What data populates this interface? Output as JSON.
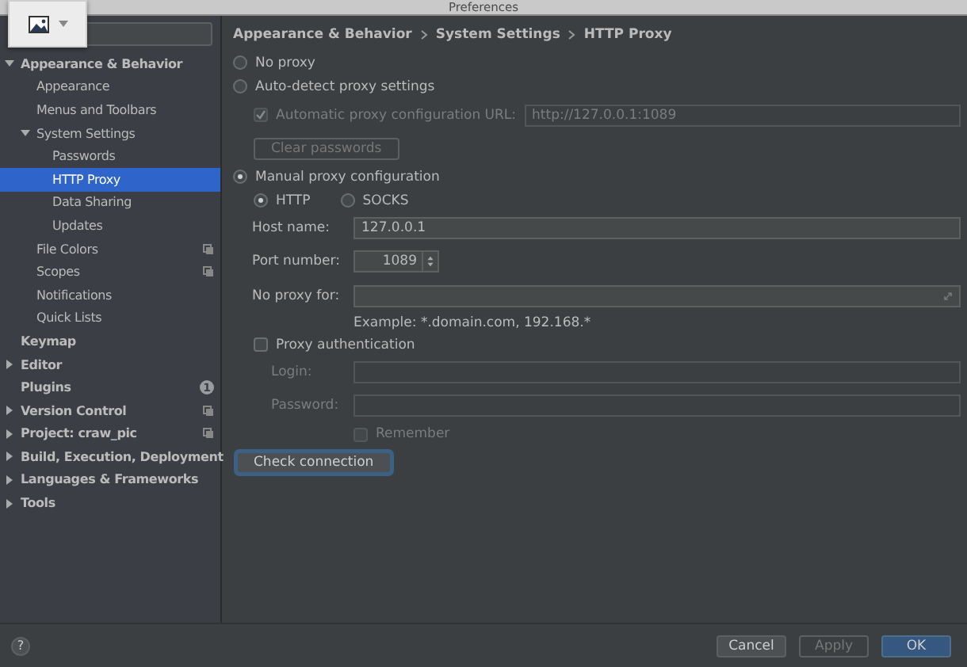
{
  "window": {
    "title": "Preferences"
  },
  "sidebar": {
    "items": [
      {
        "label": "Appearance & Behavior",
        "expanded": true,
        "selected": false,
        "children": [
          {
            "label": "Appearance",
            "selected": false
          },
          {
            "label": "Menus and Toolbars",
            "selected": false
          },
          {
            "label": "System Settings",
            "expanded": true,
            "selected": false,
            "children": [
              {
                "label": "Passwords",
                "selected": false
              },
              {
                "label": "HTTP Proxy",
                "selected": true
              },
              {
                "label": "Data Sharing",
                "selected": false
              },
              {
                "label": "Updates",
                "selected": false
              }
            ]
          },
          {
            "label": "File Colors",
            "selected": false,
            "project_scoped": true
          },
          {
            "label": "Scopes",
            "selected": false,
            "project_scoped": true
          },
          {
            "label": "Notifications",
            "selected": false
          },
          {
            "label": "Quick Lists",
            "selected": false
          }
        ]
      },
      {
        "label": "Keymap",
        "selected": false
      },
      {
        "label": "Editor",
        "expanded": false,
        "selected": false
      },
      {
        "label": "Plugins",
        "selected": false,
        "badge": "1"
      },
      {
        "label": "Version Control",
        "expanded": false,
        "selected": false,
        "project_scoped": true
      },
      {
        "label": "Project: craw_pic",
        "expanded": false,
        "selected": false,
        "project_scoped": true
      },
      {
        "label": "Build, Execution, Deployment",
        "expanded": false,
        "selected": false
      },
      {
        "label": "Languages & Frameworks",
        "expanded": false,
        "selected": false
      },
      {
        "label": "Tools",
        "expanded": false,
        "selected": false
      }
    ]
  },
  "breadcrumb": [
    "Appearance & Behavior",
    "System Settings",
    "HTTP Proxy"
  ],
  "proxy_modes": [
    {
      "label": "No proxy",
      "selected": false
    },
    {
      "label": "Auto-detect proxy settings",
      "selected": false
    },
    {
      "label": "Manual proxy configuration",
      "selected": true
    }
  ],
  "auto_config": {
    "label": "Automatic proxy configuration URL:",
    "checked": true,
    "disabled": true,
    "value": "http://127.0.0.1:1089"
  },
  "clear_passwords": {
    "label": "Clear passwords",
    "disabled": true
  },
  "protocols": [
    {
      "label": "HTTP",
      "selected": true
    },
    {
      "label": "SOCKS",
      "selected": false
    }
  ],
  "host": {
    "label": "Host name:",
    "value": "127.0.0.1"
  },
  "port": {
    "label": "Port number:",
    "value": "1089"
  },
  "no_proxy": {
    "label": "No proxy for:",
    "hint": "Example: *.domain.com, 192.168.*"
  },
  "proxy_auth": {
    "label": "Proxy authentication",
    "checked": false
  },
  "login": {
    "label": "Login:",
    "disabled": true
  },
  "password": {
    "label": "Password:",
    "disabled": true
  },
  "remember": {
    "label": "Remember",
    "checked": false,
    "disabled": true
  },
  "check_connection": {
    "label": "Check connection"
  },
  "footer": {
    "help": "?",
    "buttons": [
      {
        "label": "Cancel",
        "kind": "normal",
        "disabled": false
      },
      {
        "label": "Apply",
        "kind": "normal",
        "disabled": true
      },
      {
        "label": "OK",
        "kind": "default",
        "disabled": false
      }
    ]
  }
}
